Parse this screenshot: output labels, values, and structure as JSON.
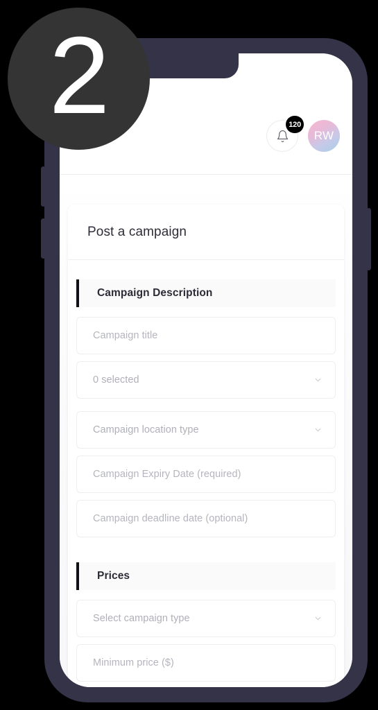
{
  "step_badge": {
    "number": "2",
    "color": "#343434"
  },
  "device": {
    "frame_color": "#353347",
    "screen_background": "#ffffff"
  },
  "header": {
    "notification": {
      "icon": "bell-icon",
      "badge_count": "120",
      "badge_color": "#000000"
    },
    "avatar": {
      "initials": "RW",
      "gradient_from": "#f6b9cf",
      "gradient_to": "#a9cfe6"
    }
  },
  "card": {
    "title": "Post a campaign",
    "sections": [
      {
        "title": "Campaign Description",
        "accent_color": "#111118",
        "fields": [
          {
            "name": "campaign-title",
            "placeholder": "Campaign title",
            "type": "text"
          },
          {
            "name": "campaign-categories",
            "placeholder": "0 selected",
            "type": "select"
          },
          {
            "name": "campaign-location-type",
            "placeholder": "Campaign location type",
            "type": "select"
          },
          {
            "name": "campaign-expiry-date",
            "placeholder": "Campaign Expiry Date (required)",
            "type": "text"
          },
          {
            "name": "campaign-deadline-date",
            "placeholder": "Campaign deadline date (optional)",
            "type": "text"
          }
        ]
      },
      {
        "title": "Prices",
        "accent_color": "#111118",
        "fields": [
          {
            "name": "campaign-type",
            "placeholder": "Select campaign type",
            "type": "select"
          },
          {
            "name": "minimum-price",
            "placeholder": "Minimum price ($)",
            "type": "text"
          }
        ]
      }
    ]
  }
}
